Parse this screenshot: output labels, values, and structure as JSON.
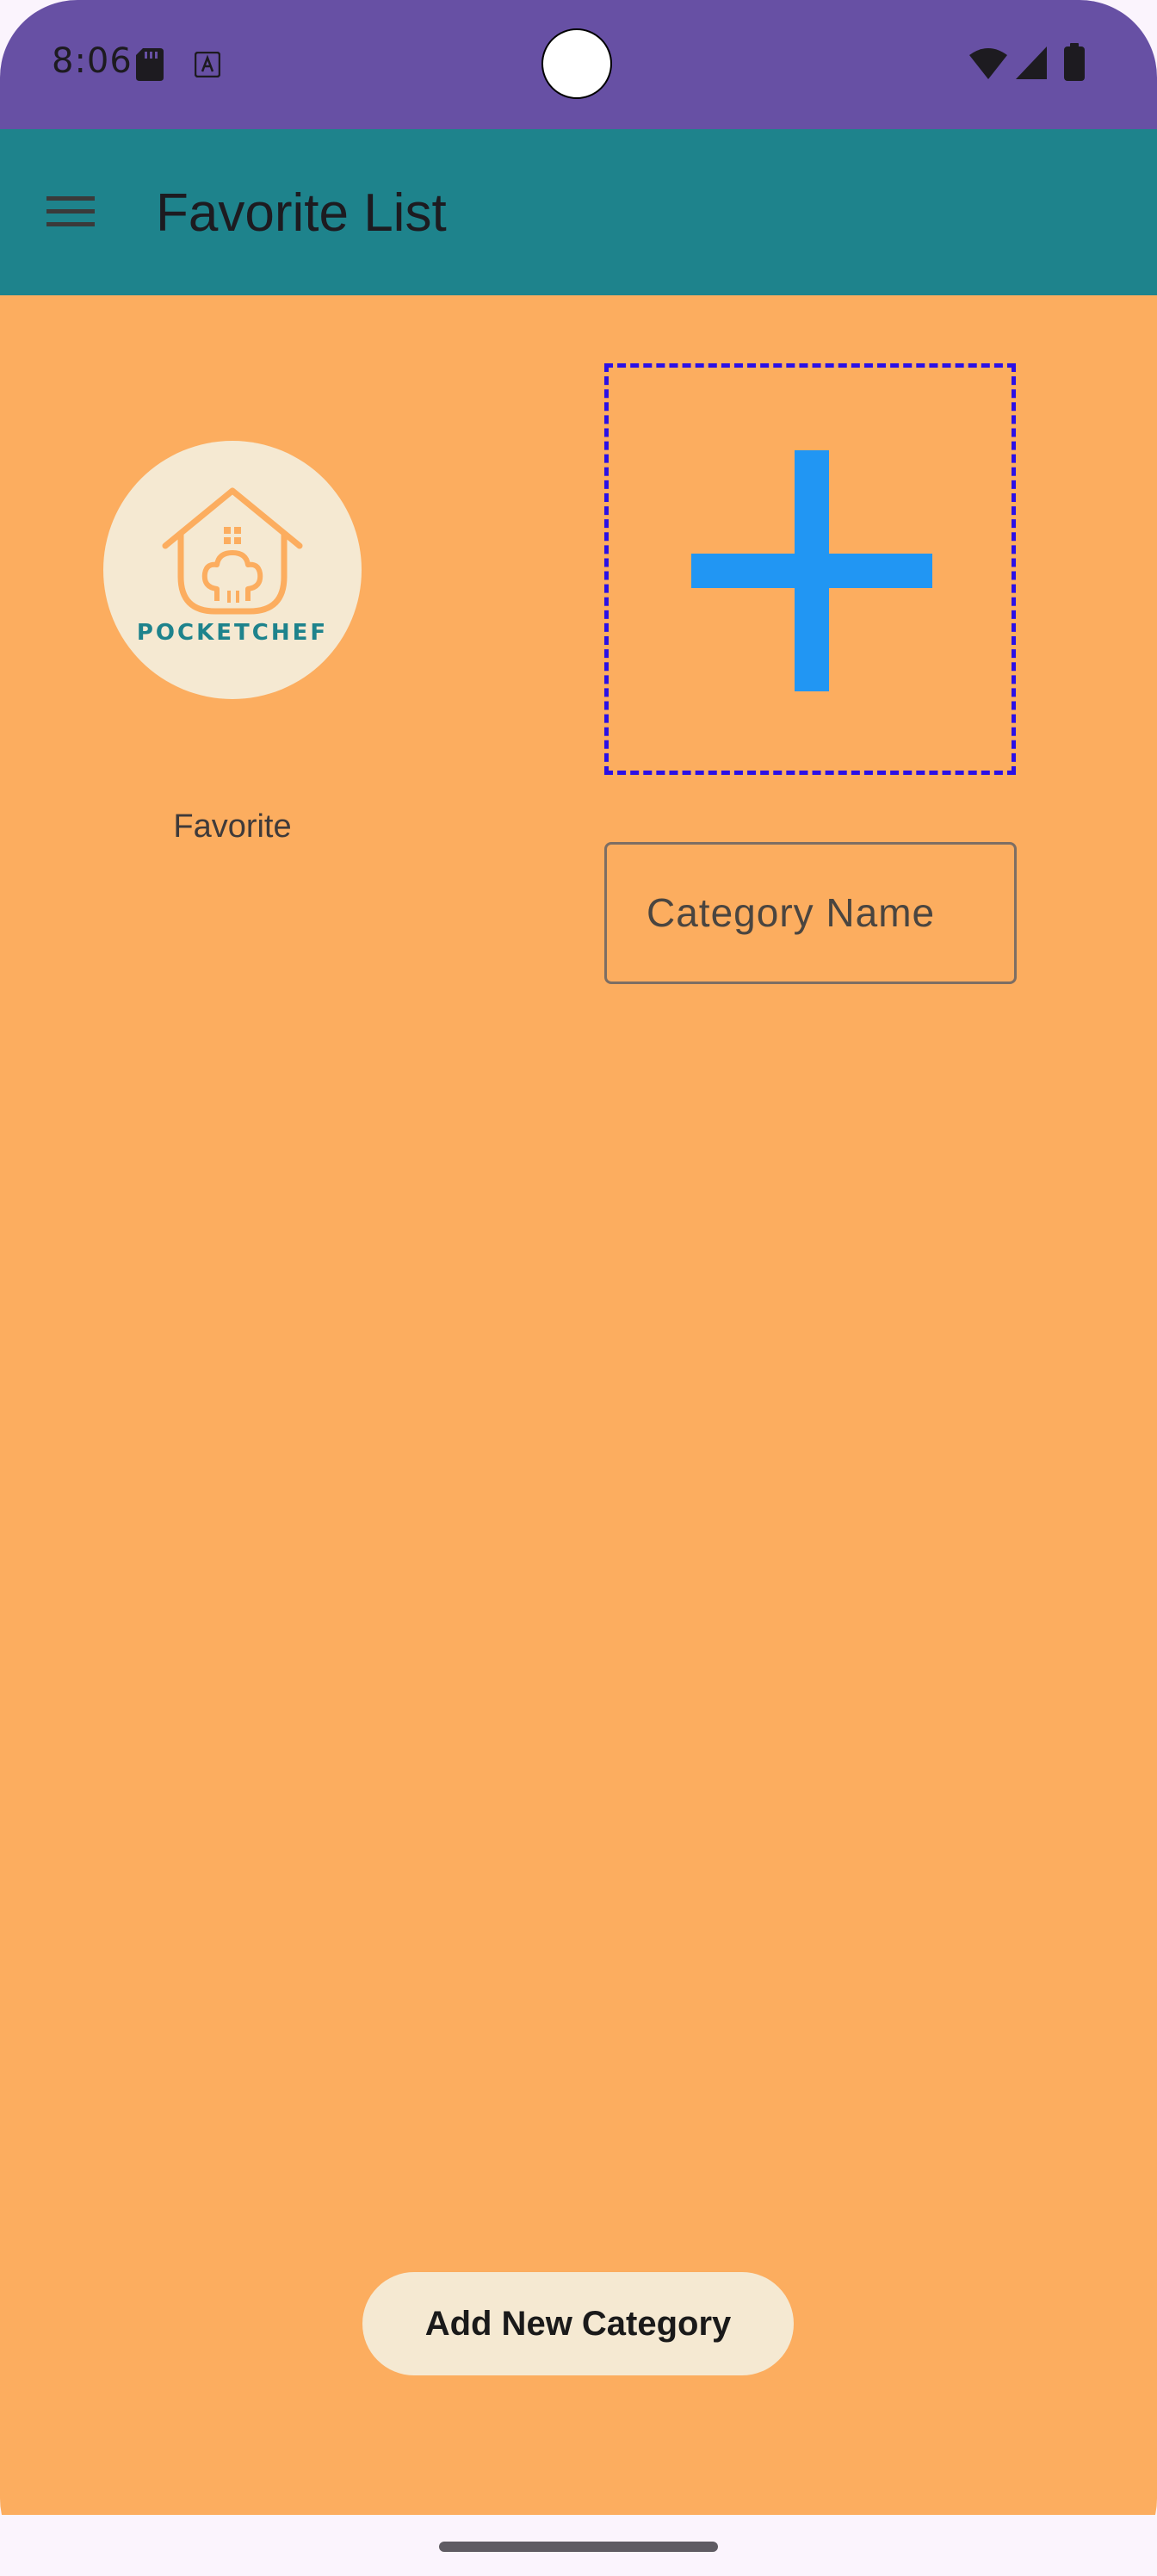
{
  "status_bar": {
    "time": "8:06",
    "icons": [
      "sd-card-icon",
      "a-notification-icon",
      "wifi-icon",
      "signal-icon",
      "battery-icon"
    ],
    "color": "#6750a4"
  },
  "app_bar": {
    "title": "Favorite List",
    "menu_icon": "hamburger-menu-icon",
    "color": "#1e838c"
  },
  "content": {
    "background": "#fcad5f",
    "favorite": {
      "logo_text": "POCKETCHEF",
      "label": "Favorite"
    },
    "add_image": {
      "icon": "plus-icon",
      "border_color": "#2b10e6",
      "icon_color": "#2196f3"
    },
    "category_field": {
      "placeholder": "Category Name",
      "value": ""
    },
    "add_button": {
      "label": "Add New Category"
    }
  }
}
